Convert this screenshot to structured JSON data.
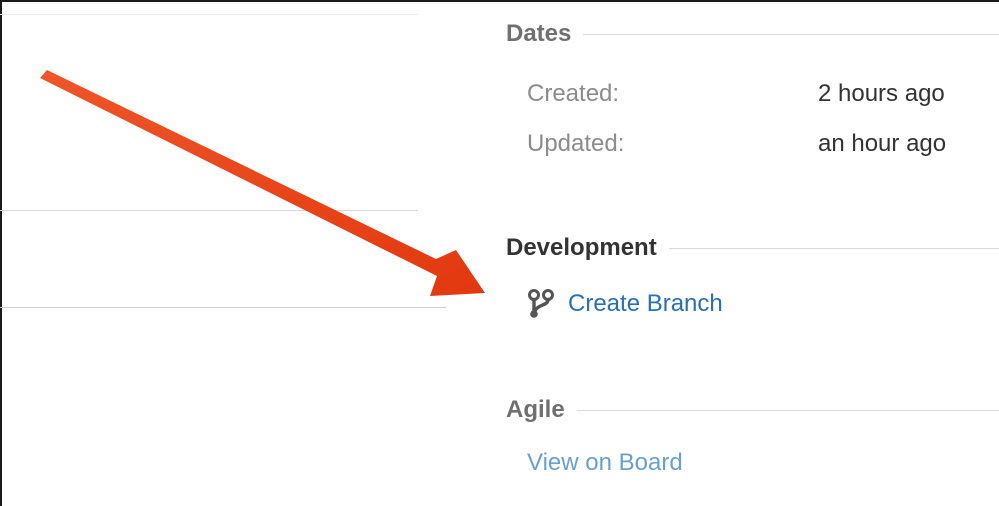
{
  "dates": {
    "title": "Dates",
    "created_label": "Created:",
    "created_value": "2 hours ago",
    "updated_label": "Updated:",
    "updated_value": "an hour ago"
  },
  "development": {
    "title": "Development",
    "create_branch_label": "Create Branch",
    "icon": "branch-icon"
  },
  "agile": {
    "title": "Agile",
    "view_on_board_label": "View on Board"
  },
  "annotation": {
    "arrow_color": "#e8401c"
  },
  "colors": {
    "link": "#2a6fb0",
    "link_light": "#6a9fce",
    "label_gray": "#8c8c8c",
    "heading": "#333333"
  }
}
